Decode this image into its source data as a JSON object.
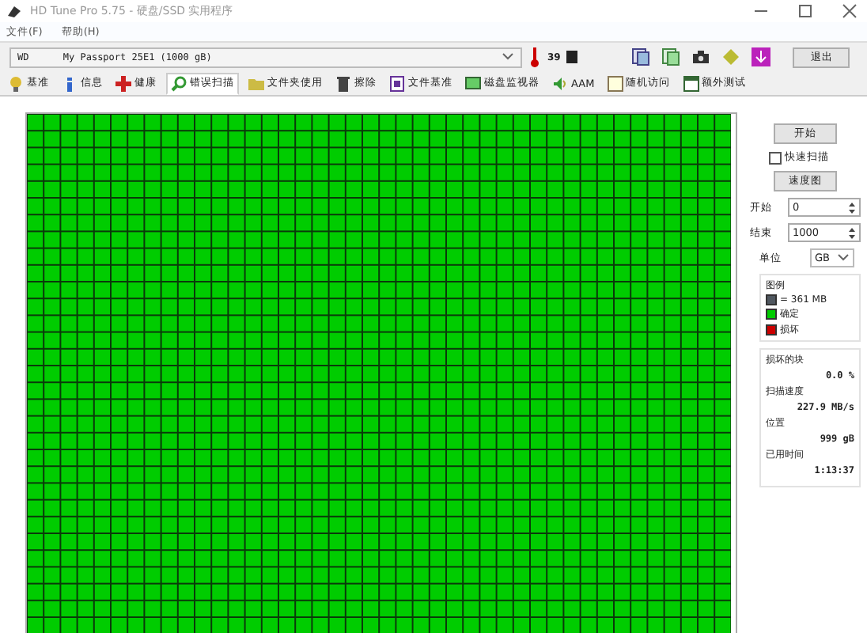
{
  "window": {
    "title": "HD Tune Pro 5.75 - 硬盘/SSD 实用程序"
  },
  "menu": [
    "文件(F)",
    "帮助(H)"
  ],
  "toolbar": {
    "drive": "WD      My Passport 25E1 (1000 gB)",
    "temperature": "39",
    "exit_button": "退出"
  },
  "tabs": [
    {
      "label": "基准",
      "selected": false
    },
    {
      "label": "信息",
      "selected": false
    },
    {
      "label": "健康",
      "selected": false
    },
    {
      "label": "错误扫描",
      "selected": true
    },
    {
      "label": "文件夹使用",
      "selected": false
    },
    {
      "label": "擦除",
      "selected": false
    },
    {
      "label": "文件基准",
      "selected": false
    },
    {
      "label": "磁盘监视器",
      "selected": false
    },
    {
      "label": "AAM",
      "selected": false
    },
    {
      "label": "随机访问",
      "selected": false
    },
    {
      "label": "额外测试",
      "selected": false
    }
  ],
  "controls": {
    "start_button": "开始",
    "quick_scan": {
      "label": "快速扫描",
      "checked": false
    },
    "speed_map_button": "速度图",
    "start": {
      "label": "开始",
      "value": "0"
    },
    "end": {
      "label": "结束",
      "value": "1000"
    },
    "unit": {
      "label": "单位",
      "value": "GB"
    }
  },
  "legend": {
    "title": "图例",
    "items": [
      {
        "label": "= 361 MB",
        "color": "#505860"
      },
      {
        "label": "确定",
        "color": "#00cc00"
      },
      {
        "label": "损坏",
        "color": "#cc0000"
      }
    ]
  },
  "stats": [
    {
      "label": "损坏的块",
      "value": "0.0 %"
    },
    {
      "label": "扫描速度",
      "value": "227.9 MB/s"
    },
    {
      "label": "位置",
      "value": "999 gB"
    },
    {
      "label": "已用时间",
      "value": "1:13:37"
    }
  ]
}
